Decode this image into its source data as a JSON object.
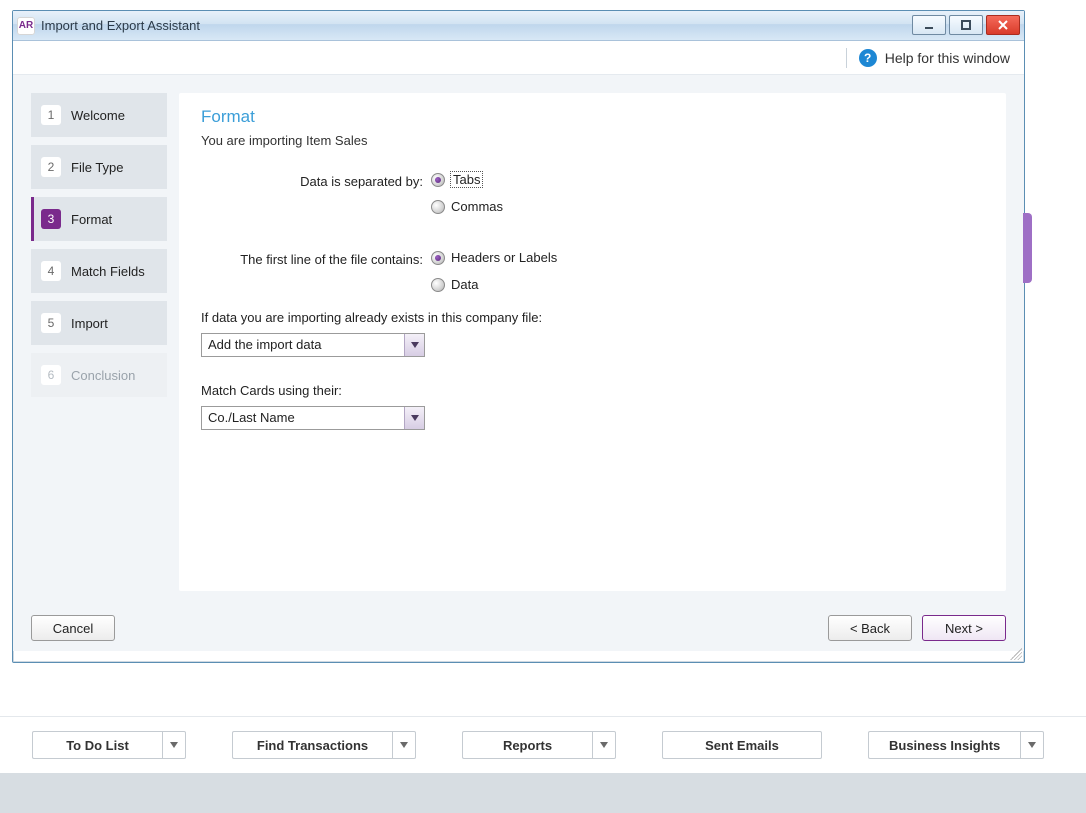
{
  "window": {
    "app_abbrev": "AR",
    "title": "Import and Export Assistant"
  },
  "help": {
    "label": "Help for this window"
  },
  "steps": [
    {
      "num": "1",
      "label": "Welcome"
    },
    {
      "num": "2",
      "label": "File Type"
    },
    {
      "num": "3",
      "label": "Format"
    },
    {
      "num": "4",
      "label": "Match Fields"
    },
    {
      "num": "5",
      "label": "Import"
    },
    {
      "num": "6",
      "label": "Conclusion"
    }
  ],
  "panel": {
    "heading": "Format",
    "subline": "You are importing Item Sales",
    "separator_label": "Data is separated by:",
    "separator_options": {
      "tabs": "Tabs",
      "commas": "Commas"
    },
    "firstline_label": "The first line of the file contains:",
    "firstline_options": {
      "headers": "Headers or Labels",
      "data": "Data"
    },
    "exists_label": "If data you are importing already exists in this company file:",
    "exists_value": "Add the import data",
    "match_label": "Match Cards using their:",
    "match_value": "Co./Last Name"
  },
  "footer": {
    "cancel": "Cancel",
    "back": "< Back",
    "next": "Next >"
  },
  "toolbar": {
    "todo": "To Do List",
    "find": "Find Transactions",
    "reports": "Reports",
    "sent": "Sent Emails",
    "insights": "Business Insights"
  }
}
